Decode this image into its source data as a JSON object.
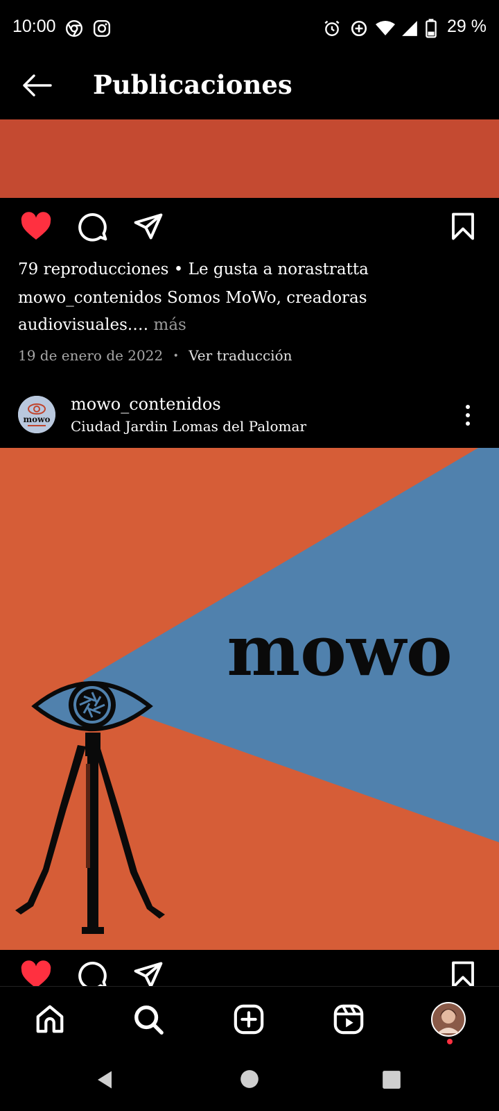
{
  "status_bar": {
    "time": "10:00",
    "battery": "29 %"
  },
  "header": {
    "title": "Publicaciones"
  },
  "prev_post": {
    "stats": "79 reproducciones • Le gusta a norastratta",
    "caption_user": "mowo_contenidos",
    "caption_text_1": "Somos MoWo, creadoras",
    "caption_text_2": "audiovisuales.…",
    "more_label": "más",
    "date": "19 de enero de 2022",
    "separator": "•",
    "translate_label": "Ver traducción",
    "liked": true
  },
  "post": {
    "username": "mowo_contenidos",
    "location": "Ciudad Jardin Lomas del Palomar",
    "avatar_text": "mowo",
    "image_logo_text": "mowo",
    "colors": {
      "orange": "#d65d37",
      "blue": "#5081ad"
    }
  },
  "colors": {
    "like_red": "#ff3040",
    "prev_media": "#c44a31",
    "background": "#000000"
  },
  "icons": {
    "back": "arrow-left-icon",
    "like": "heart-icon",
    "comment": "comment-icon",
    "share": "send-icon",
    "save": "bookmark-icon",
    "more": "more-vertical-icon",
    "nav": [
      "home-icon",
      "search-icon",
      "create-icon",
      "reels-icon",
      "profile-avatar"
    ]
  }
}
